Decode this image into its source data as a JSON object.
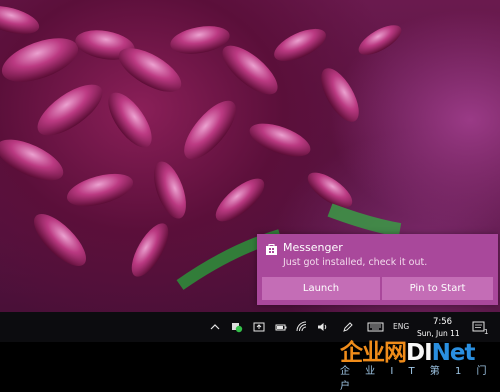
{
  "notification": {
    "app_name": "Messenger",
    "message": "Just got installed, check it out.",
    "launch_label": "Launch",
    "pin_label": "Pin to Start",
    "accent_color": "#a9489b"
  },
  "taskbar": {
    "language": "ENG",
    "time": "7:56",
    "date": "Sun, Jun 11",
    "notification_count": "1",
    "icons": [
      "chevron-up-icon",
      "green-app-icon",
      "upload-icon",
      "battery-icon",
      "wifi-icon",
      "volume-icon",
      "pen-icon",
      "keyboard-icon",
      "action-center-icon"
    ]
  },
  "watermark": {
    "logo_text": "企业网",
    "logo_brand": "D",
    "logo_suffix": "Net",
    "subtitle": "企 业 I T 第 1 门 户"
  }
}
